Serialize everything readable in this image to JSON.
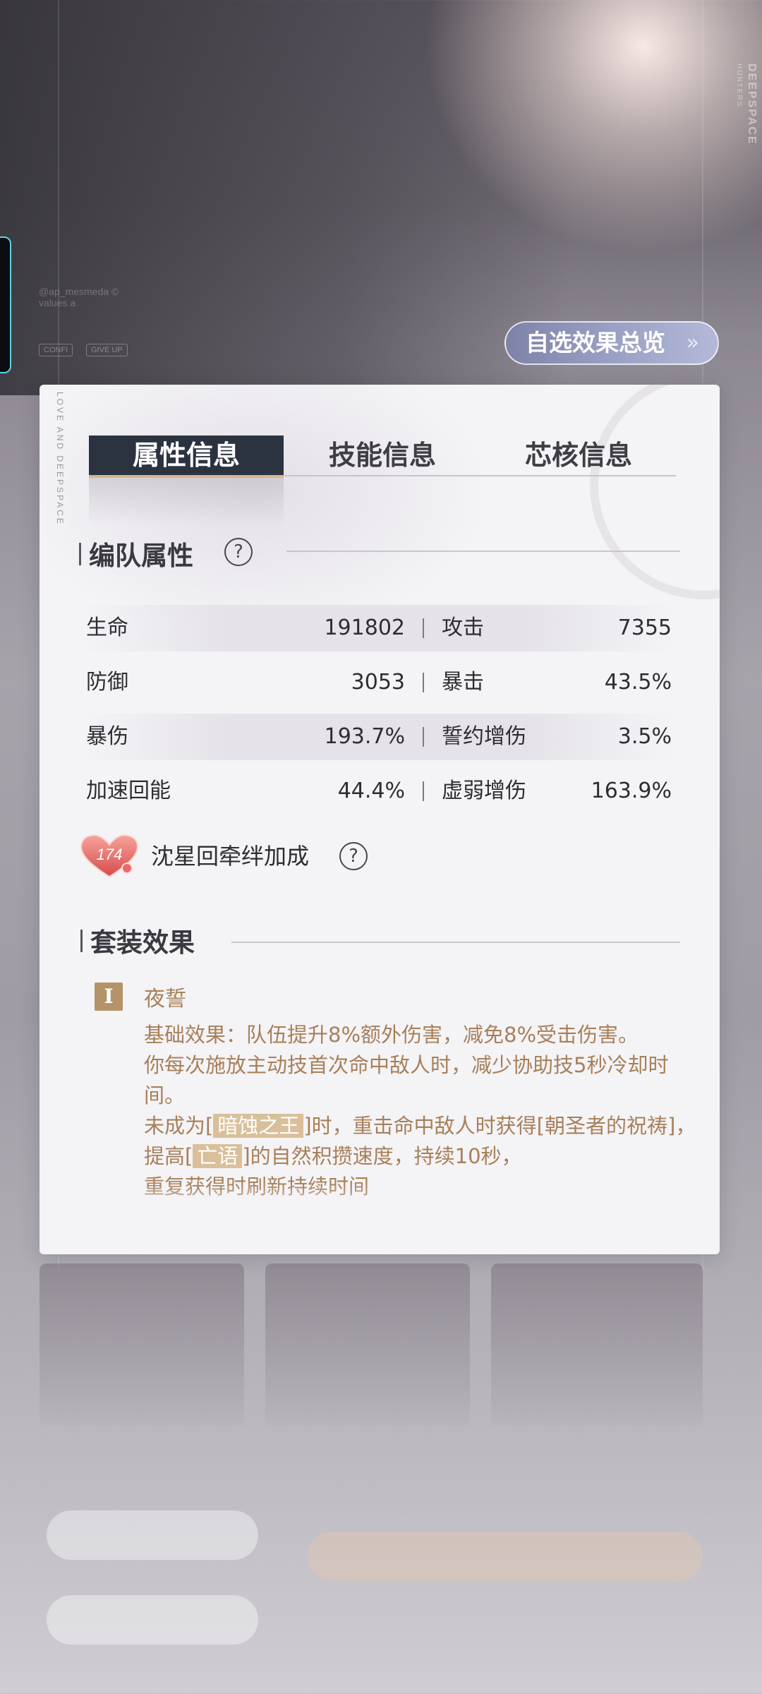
{
  "background": {
    "brand_vertical": "DEEPSPACE",
    "brand_vertical_sub": "HUNTERS",
    "blur_caption": "@ap_mesmeda ©\nvalues a",
    "blur_chips": [
      "CONFI",
      "GIVE UP"
    ]
  },
  "overview_button": {
    "label": "自选效果总览",
    "chevron": "»"
  },
  "panel": {
    "vertical_text": "LOVE AND DEEPSPACE",
    "tabs": [
      {
        "label": "属性信息",
        "active": true
      },
      {
        "label": "技能信息",
        "active": false
      },
      {
        "label": "芯核信息",
        "active": false
      }
    ],
    "team_stats": {
      "title": "编队属性",
      "help": "?",
      "rows": [
        {
          "left_label": "生命",
          "left_value": "191802",
          "right_label": "攻击",
          "right_value": "7355"
        },
        {
          "left_label": "防御",
          "left_value": "3053",
          "right_label": "暴击",
          "right_value": "43.5%"
        },
        {
          "left_label": "暴伤",
          "left_value": "193.7%",
          "right_label": "誓约增伤",
          "right_value": "3.5%"
        },
        {
          "left_label": "加速回能",
          "left_value": "44.4%",
          "right_label": "虚弱增伤",
          "right_value": "163.9%"
        }
      ]
    },
    "bond": {
      "level": "174",
      "label": "沈星回牵绊加成",
      "help": "?"
    },
    "set_effect": {
      "title": "套装效果",
      "badge": "I",
      "name": "夜誓",
      "para1": "基础效果：队伍提升8%额外伤害，减免8%受击伤害。",
      "para2": "你每次施放主动技首次命中敌人时，减少协助技5秒冷却时间。",
      "para3_prefix": "未成为[",
      "para3_hl1": "暗蚀之王",
      "para3_mid": "]时，重击命中敌人时获得[朝圣者的祝祷]，提高[",
      "para3_hl2": "亡语",
      "para3_suffix": "]的自然积攒速度，持续10秒，",
      "para4": "重复获得时刷新持续时间"
    }
  },
  "colors": {
    "tab_active_bg": "#2b3341",
    "accent_gold": "#a78059",
    "button_bg": "#9aa0c4"
  }
}
